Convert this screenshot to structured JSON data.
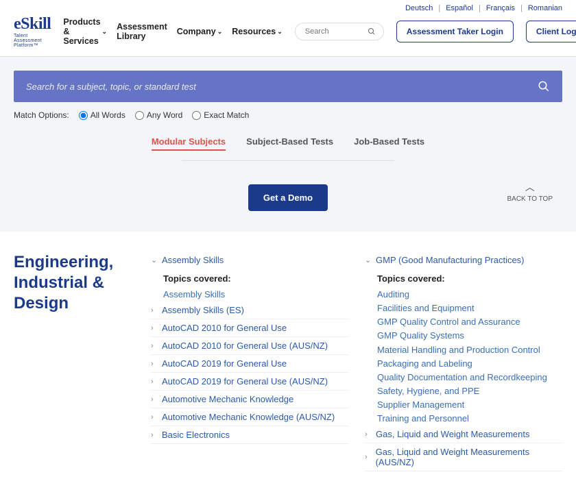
{
  "lang_links": [
    "Deutsch",
    "Español",
    "Français",
    "Romanian"
  ],
  "logo": {
    "text": "eSkill",
    "tagline": "Talent Assessment Platform™"
  },
  "nav": [
    "Products & Services",
    "Assessment Library",
    "Company",
    "Resources"
  ],
  "nav_has_dropdown": [
    true,
    false,
    true,
    true
  ],
  "search_top": {
    "placeholder": "Search"
  },
  "login_buttons": {
    "taker": "Assessment Taker Login",
    "client": "Client Login"
  },
  "big_search": {
    "placeholder": "Search for a subject, topic, or standard test"
  },
  "match": {
    "label": "Match Options:",
    "opts": [
      "All Words",
      "Any Word",
      "Exact Match"
    ],
    "selected": 0
  },
  "tabs": [
    "Modular Subjects",
    "Subject-Based Tests",
    "Job-Based Tests"
  ],
  "active_tab": 0,
  "demo_btn": "Get a Demo",
  "back_to_top": "BACK TO TOP",
  "category": "Engineering, Industrial & Design",
  "left_col": {
    "expanded": {
      "title": "Assembly Skills",
      "topics_label": "Topics covered:",
      "topics": [
        "Assembly Skills"
      ]
    },
    "rows": [
      "Assembly Skills (ES)",
      "AutoCAD 2010 for General Use",
      "AutoCAD 2010 for General Use (AUS/NZ)",
      "AutoCAD 2019 for General Use",
      "AutoCAD 2019 for General Use (AUS/NZ)",
      "Automotive Mechanic Knowledge",
      "Automotive Mechanic Knowledge (AUS/NZ)",
      "Basic Electronics"
    ]
  },
  "right_col": {
    "expanded": {
      "title": "GMP (Good Manufacturing Practices)",
      "topics_label": "Topics covered:",
      "topics": [
        "Auditing",
        "Facilities and Equipment",
        "GMP Quality Control and Assurance",
        "GMP Quality Systems",
        "Material Handling and Production Control",
        "Packaging and Labeling",
        "Quality Documentation and Recordkeeping",
        "Safety, Hygiene, and PPE",
        "Supplier Management",
        "Training and Personnel"
      ]
    },
    "rows": [
      "Gas, Liquid and Weight Measurements",
      "Gas, Liquid and Weight Measurements (AUS/NZ)"
    ]
  }
}
